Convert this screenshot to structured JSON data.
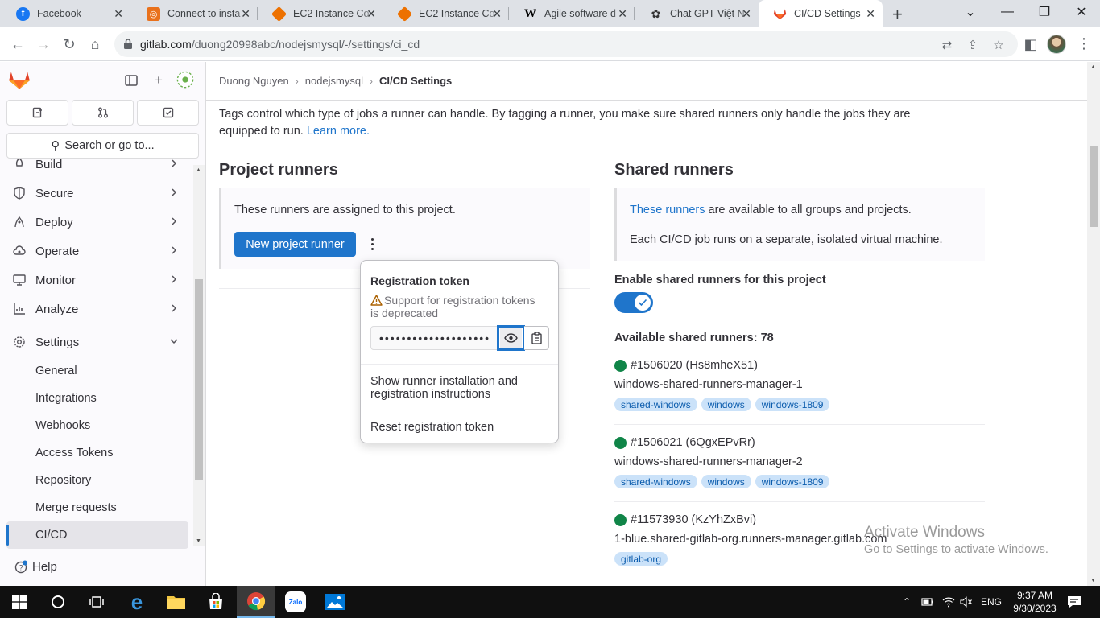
{
  "browser": {
    "tabs": [
      {
        "title": "Facebook",
        "favicon": "facebook-icon",
        "color": "#1877f2"
      },
      {
        "title": "Connect to insta",
        "favicon": "aws-console-icon",
        "color": "#e9711c"
      },
      {
        "title": "EC2 Instance Co",
        "favicon": "ec2-icon",
        "color": "#ed7100"
      },
      {
        "title": "EC2 Instance Co",
        "favicon": "ec2-icon",
        "color": "#ed7100"
      },
      {
        "title": "Agile software d",
        "favicon": "wikipedia-icon",
        "color": "#000000"
      },
      {
        "title": "Chat GPT Việt N",
        "favicon": "chatgpt-icon",
        "color": "#333333"
      },
      {
        "title": "CI/CD Settings",
        "favicon": "gitlab-icon",
        "color": "#e24329",
        "active": true
      }
    ],
    "url_host": "gitlab.com",
    "url_path": "/duong20998abc/nodejsmysql/-/settings/ci_cd"
  },
  "sidebar": {
    "search_label": "Search or go to...",
    "items": [
      {
        "label": "Build",
        "icon": "rocket-icon"
      },
      {
        "label": "Secure",
        "icon": "shield-icon"
      },
      {
        "label": "Deploy",
        "icon": "deploy-icon"
      },
      {
        "label": "Operate",
        "icon": "cloud-gear-icon"
      },
      {
        "label": "Monitor",
        "icon": "monitor-icon"
      },
      {
        "label": "Analyze",
        "icon": "chart-icon"
      },
      {
        "label": "Settings",
        "icon": "gear-icon"
      }
    ],
    "settings_sub": [
      "General",
      "Integrations",
      "Webhooks",
      "Access Tokens",
      "Repository",
      "Merge requests",
      "CI/CD"
    ],
    "help_label": "Help"
  },
  "breadcrumbs": [
    "Duong Nguyen",
    "nodejsmysql",
    "CI/CD Settings"
  ],
  "intro": {
    "text": "Tags control which type of jobs a runner can handle. By tagging a runner, you make sure shared runners only handle the jobs they are equipped to run.",
    "link": "Learn more."
  },
  "project_runners": {
    "heading": "Project runners",
    "desc": "These runners are assigned to this project.",
    "new_button": "New project runner"
  },
  "popover": {
    "title": "Registration token",
    "warning": "Support for registration tokens is deprecated",
    "token_masked": "••••••••••••••••••••",
    "show_instructions": "Show runner installation and registration instructions",
    "reset": "Reset registration token"
  },
  "shared_runners": {
    "heading": "Shared runners",
    "link": "These runners",
    "desc1_rest": "are available to all groups and projects.",
    "desc2": "Each CI/CD job runs on a separate, isolated virtual machine.",
    "enable_label": "Enable shared runners for this project",
    "enabled": true,
    "available_label": "Available shared runners: 78",
    "runners": [
      {
        "id": "#1506020 (Hs8mheX51)",
        "name": "windows-shared-runners-manager-1",
        "tags": [
          "shared-windows",
          "windows",
          "windows-1809"
        ],
        "status_color": "#108548"
      },
      {
        "id": "#1506021 (6QgxEPvRr)",
        "name": "windows-shared-runners-manager-2",
        "tags": [
          "shared-windows",
          "windows",
          "windows-1809"
        ],
        "status_color": "#108548"
      },
      {
        "id": "#11573930 (KzYhZxBvi)",
        "name": "1-blue.shared-gitlab-org.runners-manager.gitlab.com",
        "tags": [
          "gitlab-org"
        ],
        "status_color": "#108548"
      }
    ]
  },
  "watermark": {
    "line1": "Activate Windows",
    "line2": "Go to Settings to activate Windows."
  },
  "taskbar": {
    "lang": "ENG",
    "time": "9:37 AM",
    "date": "9/30/2023"
  }
}
